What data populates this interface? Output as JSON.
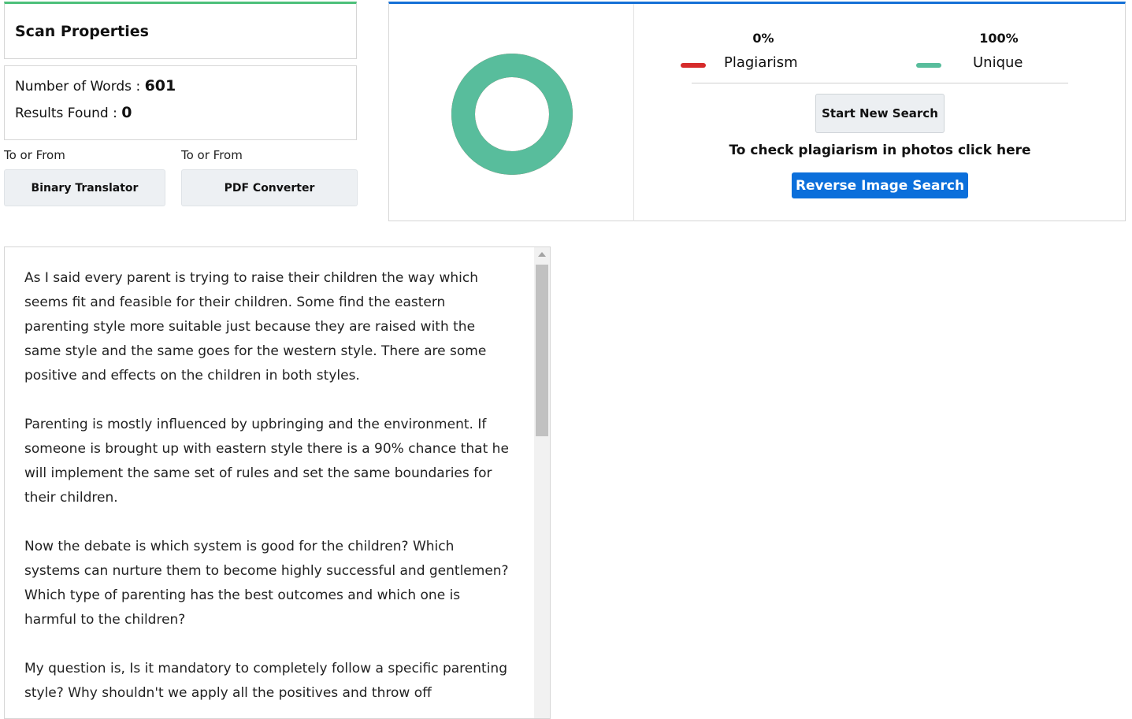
{
  "scan_properties": {
    "title": "Scan Properties",
    "words_label": "Number of Words : ",
    "words_value": "601",
    "results_label": "Results Found : ",
    "results_value": "0"
  },
  "tools": [
    {
      "caption": "To or From",
      "label": "Binary Translator"
    },
    {
      "caption": "To or From",
      "label": "PDF Converter"
    }
  ],
  "result": {
    "plagiarism_pct": "0%",
    "plagiarism_label": "Plagiarism",
    "unique_pct": "100%",
    "unique_label": "Unique",
    "new_search_label": "Start New Search",
    "photo_text": "To check plagiarism in photos click here",
    "reverse_label": "Reverse Image Search",
    "unique_fraction": 1.0,
    "colors": {
      "plagiarism": "#d62b2b",
      "unique": "#58bd9c"
    }
  },
  "text": {
    "paragraphs": [
      "As I said every parent is trying to raise their children the way which seems fit and feasible for their children. Some find the eastern parenting style more suitable just because they are raised with the same style and the same goes for the western style. There are some positive and effects on the children in both styles.",
      "Parenting is mostly influenced by upbringing and the environment. If someone is brought up with eastern style there is a 90% chance that he will implement the same set of rules and set the same boundaries for their children.",
      "Now the debate is which system is good for the children? Which systems can nurture them to become highly successful and gentlemen? Which type of parenting has the best outcomes and which one is harmful to the children?",
      "My question is, Is it mandatory to completely follow a specific parenting style? Why shouldn't we apply all the positives and throw off"
    ]
  }
}
